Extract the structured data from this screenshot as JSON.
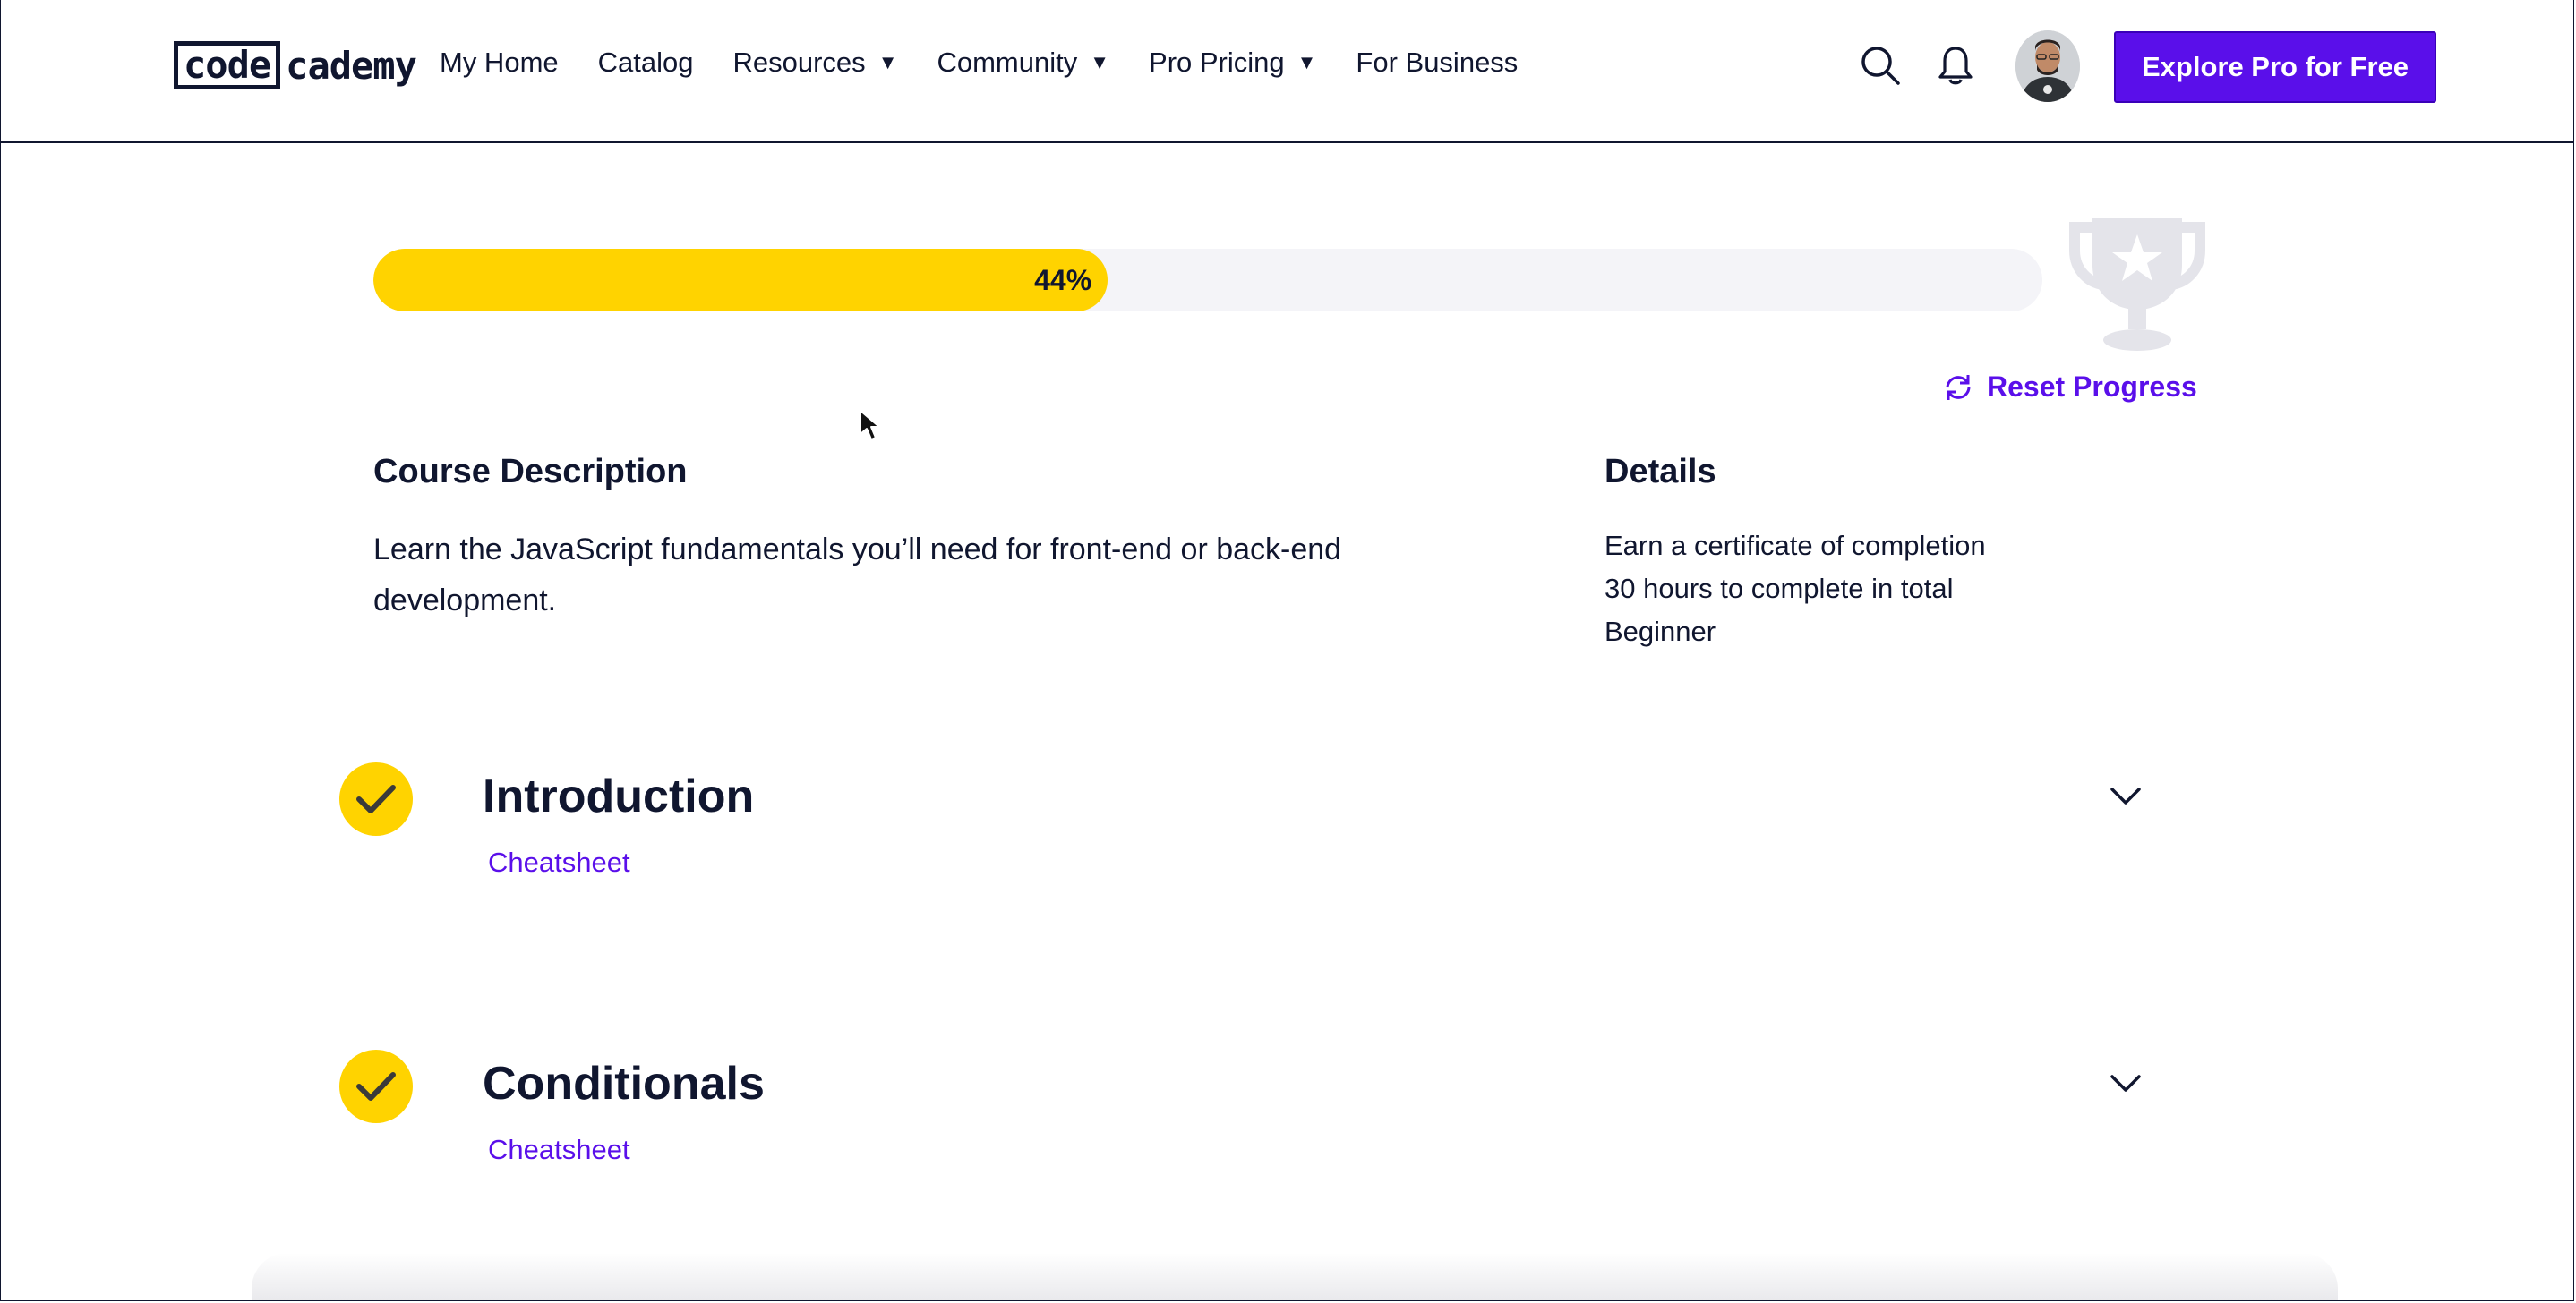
{
  "header": {
    "logo_box": "code",
    "logo_rest": "cademy",
    "nav": [
      {
        "label": "My Home",
        "has_caret": false
      },
      {
        "label": "Catalog",
        "has_caret": false
      },
      {
        "label": "Resources",
        "has_caret": true
      },
      {
        "label": "Community",
        "has_caret": true
      },
      {
        "label": "Pro Pricing",
        "has_caret": true
      },
      {
        "label": "For Business",
        "has_caret": false
      }
    ],
    "caret": "▼",
    "icons": [
      "search-icon",
      "bell-icon"
    ],
    "cta_label": "Explore Pro for Free"
  },
  "progress": {
    "percent": 44,
    "percent_label": "44%",
    "reset_label": "Reset Progress"
  },
  "description": {
    "heading": "Course Description",
    "text": "Learn the JavaScript fundamentals you’ll need for front-end or back-end development."
  },
  "details": {
    "heading": "Details",
    "items": [
      "Earn a certificate of completion",
      "30 hours to complete in total",
      "Beginner"
    ]
  },
  "modules": [
    {
      "title": "Introduction",
      "link": "Cheatsheet",
      "completed": true
    },
    {
      "title": "Conditionals",
      "link": "Cheatsheet",
      "completed": true
    }
  ],
  "colors": {
    "brand_purple": "#5a0fea",
    "progress_yellow": "#ffd300",
    "navy": "#10162f",
    "track": "#f4f4f8"
  }
}
